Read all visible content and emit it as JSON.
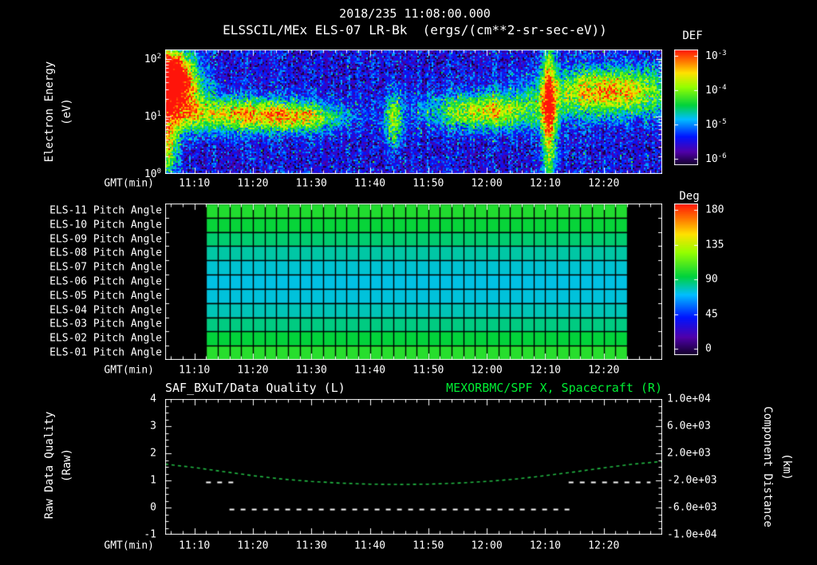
{
  "header": {
    "timestamp": "2018/235 11:08:00.000",
    "subtitle": "ELSSCIL/MEx ELS-07 LR-Bk  (ergs/(cm**2-sr-sec-eV))"
  },
  "colors": {
    "background": "#000000",
    "text": "#ffffff",
    "axis": "#ffffff",
    "title_green": "#00ee33",
    "curve_green": "#22bb44"
  },
  "x_axis": {
    "label": "GMT(min)",
    "range": [
      "11:05",
      "12:30"
    ],
    "ticks": [
      "11:10",
      "11:20",
      "11:30",
      "11:40",
      "11:50",
      "12:00",
      "12:10",
      "12:20"
    ],
    "minor_tick_minutes": 2
  },
  "chart_data": [
    {
      "id": "electron-energy-spectrogram",
      "type": "heatmap",
      "title": "ELSSCIL/MEx ELS-07 LR-Bk",
      "units_label": "(ergs/(cm**2-sr-sec-eV))",
      "ylabel": "Electron Energy",
      "ylabel_units": "(eV)",
      "y_scale": "log",
      "y_decade_exponents": [
        0,
        1,
        2
      ],
      "colorbar": {
        "label": "DEF",
        "scale": "log",
        "tick_exponents": [
          -3,
          -4,
          -5,
          -6
        ],
        "top_exponent": -3,
        "bottom_exponent": -6
      },
      "background": {
        "base_level": 0.1,
        "noise_amp": 0.24,
        "dropout_fraction": 0.13,
        "hot_pixel_fraction": 0.02
      },
      "features": [
        {
          "name": "left-edge high-energy burst",
          "t_center_min": 0.5,
          "t_sigma_min": 2.5,
          "log_e_center": 1.75,
          "log_e_sigma": 0.32,
          "amplitude": 0.95
        },
        {
          "name": "left-edge full-column glow",
          "t_center_min": 0.3,
          "t_sigma_min": 1.2,
          "log_e_center": 0.6,
          "log_e_sigma": 0.5,
          "amplitude": 0.5
        },
        {
          "name": "left mid-energy burst",
          "t_center_min": 2.5,
          "t_sigma_min": 3.0,
          "log_e_center": 1.35,
          "log_e_sigma": 0.4,
          "amplitude": 0.55
        },
        {
          "name": "morning green band",
          "t_center_min": 13,
          "t_sigma_min": 7,
          "log_e_center": 1.05,
          "log_e_sigma": 0.2,
          "amplitude": 0.62
        },
        {
          "name": "band fade tail",
          "t_center_min": 24,
          "t_sigma_min": 5,
          "log_e_center": 1.0,
          "log_e_sigma": 0.17,
          "amplitude": 0.42
        },
        {
          "name": "mid faint streak",
          "t_center_min": 39,
          "t_sigma_min": 1.2,
          "log_e_center": 0.95,
          "log_e_sigma": 0.3,
          "amplitude": 0.4
        },
        {
          "name": "afternoon band onset",
          "t_center_min": 55,
          "t_sigma_min": 7,
          "log_e_center": 1.1,
          "log_e_sigma": 0.22,
          "amplitude": 0.55
        },
        {
          "name": "bright vertical streak 12:10",
          "t_center_min": 65.5,
          "t_sigma_min": 0.9,
          "log_e_center": 1.1,
          "log_e_sigma": 0.8,
          "amplitude": 0.72
        },
        {
          "name": "late bright band",
          "t_center_min": 76,
          "t_sigma_min": 8,
          "log_e_center": 1.45,
          "log_e_sigma": 0.28,
          "amplitude": 0.66
        }
      ]
    },
    {
      "id": "pitch-angle-grid",
      "type": "heatmap",
      "rows": [
        {
          "label": "ELS-11 Pitch Angle",
          "pitch_deg": 100
        },
        {
          "label": "ELS-10 Pitch Angle",
          "pitch_deg": 95
        },
        {
          "label": "ELS-09 Pitch Angle",
          "pitch_deg": 88
        },
        {
          "label": "ELS-08 Pitch Angle",
          "pitch_deg": 82
        },
        {
          "label": "ELS-07 Pitch Angle",
          "pitch_deg": 77
        },
        {
          "label": "ELS-06 Pitch Angle",
          "pitch_deg": 75
        },
        {
          "label": "ELS-05 Pitch Angle",
          "pitch_deg": 76
        },
        {
          "label": "ELS-04 Pitch Angle",
          "pitch_deg": 80
        },
        {
          "label": "ELS-03 Pitch Angle",
          "pitch_deg": 86
        },
        {
          "label": "ELS-02 Pitch Angle",
          "pitch_deg": 94
        },
        {
          "label": "ELS-01 Pitch Angle",
          "pitch_deg": 101
        }
      ],
      "data_time_range": [
        "11:12",
        "12:24"
      ],
      "cell_minutes": 2,
      "colorbar": {
        "label": "Deg",
        "ticks": [
          180,
          135,
          90,
          45,
          0
        ],
        "min": 0,
        "max": 180
      }
    },
    {
      "id": "quality-and-distance",
      "type": "line",
      "title_left": "SAF_BXuT/Data Quality (L)",
      "title_right": "MEXORBMC/SPF X, Spacecraft (R)",
      "ylabel_left": "Raw Data Quality",
      "ylabel_left_units": "(Raw)",
      "ylabel_right": "Component Distance",
      "ylabel_right_units": "(km)",
      "y_left": {
        "ticks": [
          4,
          3,
          2,
          1,
          0,
          -1
        ],
        "min": -1,
        "max": 4
      },
      "y_right": {
        "ticks": [
          "1.0e+04",
          "6.0e+03",
          "2.0e+03",
          "-2.0e+03",
          "-6.0e+03",
          "-1.0e+04"
        ],
        "min": -10000,
        "max": 10000
      },
      "series": [
        {
          "name": "MEXORBMC/SPF X, Spacecraft",
          "axis": "right",
          "style": "dashed",
          "color": "#22bb44",
          "points": [
            [
              "11:05",
              400
            ],
            [
              "11:10",
              -100
            ],
            [
              "11:15",
              -700
            ],
            [
              "11:20",
              -1300
            ],
            [
              "11:25",
              -1800
            ],
            [
              "11:30",
              -2150
            ],
            [
              "11:35",
              -2400
            ],
            [
              "11:40",
              -2550
            ],
            [
              "11:45",
              -2600
            ],
            [
              "11:50",
              -2550
            ],
            [
              "11:55",
              -2400
            ],
            [
              "12:00",
              -2150
            ],
            [
              "12:05",
              -1800
            ],
            [
              "12:10",
              -1300
            ],
            [
              "12:15",
              -750
            ],
            [
              "12:20",
              -150
            ],
            [
              "12:25",
              400
            ],
            [
              "12:30",
              800
            ]
          ]
        },
        {
          "name": "SAF_BXuT Data Quality",
          "axis": "left",
          "style": "dashed",
          "color": "#ffffff",
          "segments": [
            {
              "value": 0.95,
              "from": "11:12",
              "to": "11:17"
            },
            {
              "value": -0.05,
              "from": "11:16",
              "to": "12:15"
            },
            {
              "value": 0.95,
              "from": "12:14",
              "to": "12:28"
            }
          ]
        }
      ]
    }
  ]
}
